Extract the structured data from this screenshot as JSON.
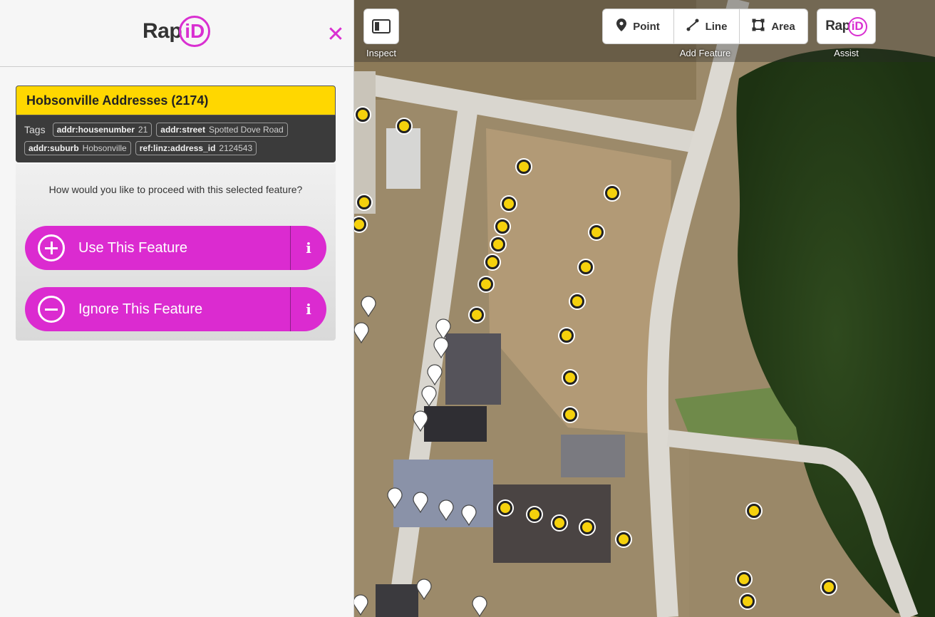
{
  "sidebar": {
    "logo": {
      "text": "Rap",
      "ring": "iD"
    },
    "close_symbol": "✕"
  },
  "feature": {
    "title": "Hobsonville Addresses (2174)",
    "tags_label": "Tags",
    "tags": [
      {
        "key": "addr:housenumber",
        "value": "21"
      },
      {
        "key": "addr:street",
        "value": "Spotted Dove Road"
      },
      {
        "key": "addr:suburb",
        "value": "Hobsonville"
      },
      {
        "key": "ref:linz:address_id",
        "value": "2124543"
      }
    ]
  },
  "actions": {
    "prompt": "How would you like to proceed with this selected feature?",
    "use_label": "Use This Feature",
    "ignore_label": "Ignore This Feature",
    "info_symbol": "i"
  },
  "toolbar": {
    "inspect_caption": "Inspect",
    "point_label": "Point",
    "line_label": "Line",
    "area_label": "Area",
    "add_feature_caption": "Add Feature",
    "assist_caption": "Assist",
    "assist_logo": {
      "text": "Rap",
      "ring": "iD"
    }
  },
  "colors": {
    "accent": "#db2bd0",
    "feature_highlight": "#ffd700",
    "point_fill": "#f5d10c"
  },
  "icons": {
    "close": "close-icon",
    "inspect": "sidebar-toggle-icon",
    "point": "map-marker-icon",
    "line": "line-icon",
    "area": "area-icon",
    "use": "plus-circle-icon",
    "ignore": "minus-circle-icon",
    "info": "info-icon"
  }
}
